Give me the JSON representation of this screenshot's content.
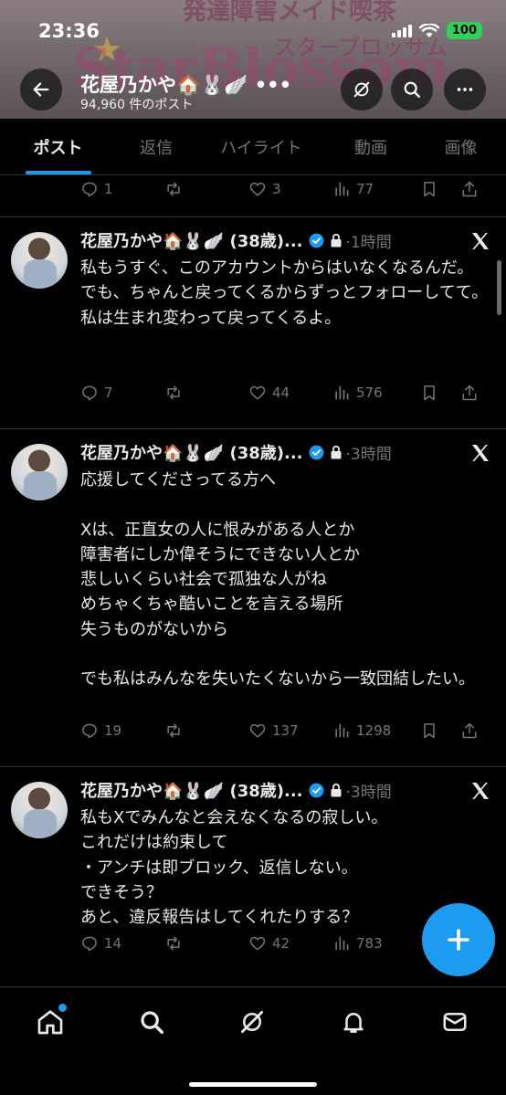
{
  "status_bar": {
    "time": "23:36",
    "battery": "100"
  },
  "banner": {
    "top_text": "発達障害メイド喫茶",
    "kana_text": "スターブロッサム",
    "big_text": "StarBlossom"
  },
  "profile": {
    "name": "花屋乃かや🏠🐰🪽 •••",
    "post_count": "94,960 件のポスト"
  },
  "tabs": [
    {
      "label": "ポスト",
      "active": true
    },
    {
      "label": "返信"
    },
    {
      "label": "ハイライト"
    },
    {
      "label": "動画"
    },
    {
      "label": "画像"
    }
  ],
  "prev_post_actions": {
    "replies": "1",
    "reposts": "",
    "likes": "3",
    "views": "77"
  },
  "posts": [
    {
      "author": "花屋乃かや🏠🐰🪽 (38歳)...",
      "time": "·1時間",
      "text": "私もうすぐ、このアカウントからはいなくなるんだ。\nでも、ちゃんと戻ってくるからずっとフォローしてて。\n私は生まれ変わって戻ってくるよ。",
      "replies": "7",
      "reposts": "",
      "likes": "44",
      "views": "576"
    },
    {
      "author": "花屋乃かや🏠🐰🪽 (38歳)...",
      "time": "·3時間",
      "text": "応援してくださってる方へ\n\nXは、正直女の人に恨みがある人とか\n障害者にしか偉そうにできない人とか\n悲しいくらい社会で孤独な人がね\nめちゃくちゃ酷いことを言える場所\n失うものがないから\n\nでも私はみんなを失いたくないから一致団結したい。",
      "replies": "19",
      "reposts": "",
      "likes": "137",
      "views": "1298"
    },
    {
      "author": "花屋乃かや🏠🐰🪽 (38歳)...",
      "time": "·3時間",
      "text": "私もXでみんなと会えなくなるの寂しい。\nこれだけは約束して\n・アンチは即ブロック、返信しない。\nできそう？\nあと、違反報告はしてくれたりする？",
      "replies": "14",
      "reposts": "",
      "likes": "42",
      "views": "783"
    }
  ],
  "colors": {
    "accent": "#1d9bf0",
    "verified": "#1d9bf0",
    "muted": "#71767b",
    "battery": "#30d158"
  },
  "icons": [
    "back-arrow-icon",
    "grok-icon",
    "search-icon",
    "more-icon",
    "reply-icon",
    "repost-icon",
    "like-icon",
    "views-icon",
    "bookmark-icon",
    "share-icon",
    "x-logo-icon",
    "verified-icon",
    "lock-icon",
    "compose-icon",
    "home-icon",
    "explore-icon",
    "bell-icon",
    "mail-icon"
  ]
}
